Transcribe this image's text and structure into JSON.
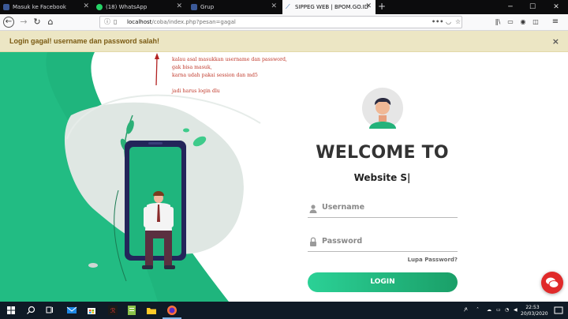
{
  "browser": {
    "tabs": [
      {
        "title": "Masuk ke Facebook",
        "favicon": "facebook-icon",
        "color": "#3b5998"
      },
      {
        "title": "(18) WhatsApp",
        "favicon": "whatsapp-icon",
        "color": "#25d366"
      },
      {
        "title": "Grup",
        "favicon": "facebook-icon",
        "color": "#3b5998"
      },
      {
        "title": "SIPPEG WEB | BPOM.GO.ID",
        "favicon": "bpom-icon",
        "color": "#1a5aa6"
      }
    ],
    "address": {
      "host": "localhost",
      "path": "/coba/index.php?pesan=gagal"
    },
    "page_actions": "•••"
  },
  "alert": {
    "message": "Login gagal! username dan password salah!",
    "close": "×"
  },
  "notes": {
    "line1": "kalau asal masukkan username dan password,",
    "line2": "gak bisa masuk,",
    "line3": "karna udah pakai session dan md5",
    "line4": "jadi harus login dlu"
  },
  "login": {
    "welcome": "WELCOME TO",
    "site": "Website S|",
    "username_placeholder": "Username",
    "password_placeholder": "Password",
    "forgot": "Lupa Password?",
    "button": "LOGIN"
  },
  "taskbar": {
    "tray_label": "ዶ",
    "time": "22:53",
    "date": "20/03/2020"
  },
  "colors": {
    "accent_green": "#1fb57d",
    "alert_bg": "#ece6c4",
    "alert_text": "#7a5a12",
    "annotation_red": "#c0392b"
  }
}
